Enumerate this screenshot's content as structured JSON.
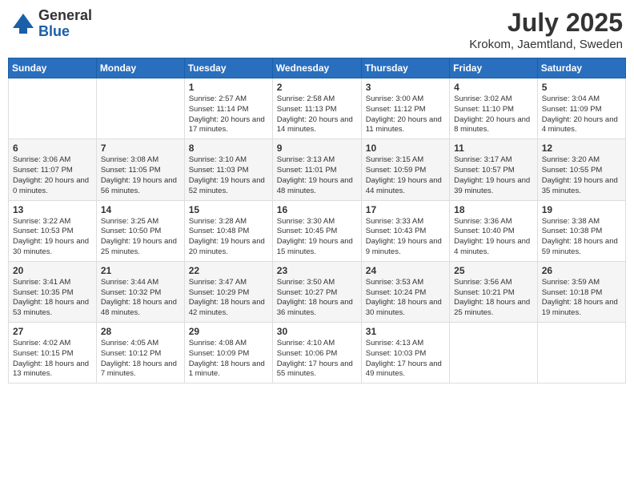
{
  "header": {
    "logo_general": "General",
    "logo_blue": "Blue",
    "month_year": "July 2025",
    "location": "Krokom, Jaemtland, Sweden"
  },
  "weekdays": [
    "Sunday",
    "Monday",
    "Tuesday",
    "Wednesday",
    "Thursday",
    "Friday",
    "Saturday"
  ],
  "weeks": [
    [
      {
        "day": "",
        "content": ""
      },
      {
        "day": "",
        "content": ""
      },
      {
        "day": "1",
        "content": "Sunrise: 2:57 AM\nSunset: 11:14 PM\nDaylight: 20 hours\nand 17 minutes."
      },
      {
        "day": "2",
        "content": "Sunrise: 2:58 AM\nSunset: 11:13 PM\nDaylight: 20 hours\nand 14 minutes."
      },
      {
        "day": "3",
        "content": "Sunrise: 3:00 AM\nSunset: 11:12 PM\nDaylight: 20 hours\nand 11 minutes."
      },
      {
        "day": "4",
        "content": "Sunrise: 3:02 AM\nSunset: 11:10 PM\nDaylight: 20 hours\nand 8 minutes."
      },
      {
        "day": "5",
        "content": "Sunrise: 3:04 AM\nSunset: 11:09 PM\nDaylight: 20 hours\nand 4 minutes."
      }
    ],
    [
      {
        "day": "6",
        "content": "Sunrise: 3:06 AM\nSunset: 11:07 PM\nDaylight: 20 hours\nand 0 minutes."
      },
      {
        "day": "7",
        "content": "Sunrise: 3:08 AM\nSunset: 11:05 PM\nDaylight: 19 hours\nand 56 minutes."
      },
      {
        "day": "8",
        "content": "Sunrise: 3:10 AM\nSunset: 11:03 PM\nDaylight: 19 hours\nand 52 minutes."
      },
      {
        "day": "9",
        "content": "Sunrise: 3:13 AM\nSunset: 11:01 PM\nDaylight: 19 hours\nand 48 minutes."
      },
      {
        "day": "10",
        "content": "Sunrise: 3:15 AM\nSunset: 10:59 PM\nDaylight: 19 hours\nand 44 minutes."
      },
      {
        "day": "11",
        "content": "Sunrise: 3:17 AM\nSunset: 10:57 PM\nDaylight: 19 hours\nand 39 minutes."
      },
      {
        "day": "12",
        "content": "Sunrise: 3:20 AM\nSunset: 10:55 PM\nDaylight: 19 hours\nand 35 minutes."
      }
    ],
    [
      {
        "day": "13",
        "content": "Sunrise: 3:22 AM\nSunset: 10:53 PM\nDaylight: 19 hours\nand 30 minutes."
      },
      {
        "day": "14",
        "content": "Sunrise: 3:25 AM\nSunset: 10:50 PM\nDaylight: 19 hours\nand 25 minutes."
      },
      {
        "day": "15",
        "content": "Sunrise: 3:28 AM\nSunset: 10:48 PM\nDaylight: 19 hours\nand 20 minutes."
      },
      {
        "day": "16",
        "content": "Sunrise: 3:30 AM\nSunset: 10:45 PM\nDaylight: 19 hours\nand 15 minutes."
      },
      {
        "day": "17",
        "content": "Sunrise: 3:33 AM\nSunset: 10:43 PM\nDaylight: 19 hours\nand 9 minutes."
      },
      {
        "day": "18",
        "content": "Sunrise: 3:36 AM\nSunset: 10:40 PM\nDaylight: 19 hours\nand 4 minutes."
      },
      {
        "day": "19",
        "content": "Sunrise: 3:38 AM\nSunset: 10:38 PM\nDaylight: 18 hours\nand 59 minutes."
      }
    ],
    [
      {
        "day": "20",
        "content": "Sunrise: 3:41 AM\nSunset: 10:35 PM\nDaylight: 18 hours\nand 53 minutes."
      },
      {
        "day": "21",
        "content": "Sunrise: 3:44 AM\nSunset: 10:32 PM\nDaylight: 18 hours\nand 48 minutes."
      },
      {
        "day": "22",
        "content": "Sunrise: 3:47 AM\nSunset: 10:29 PM\nDaylight: 18 hours\nand 42 minutes."
      },
      {
        "day": "23",
        "content": "Sunrise: 3:50 AM\nSunset: 10:27 PM\nDaylight: 18 hours\nand 36 minutes."
      },
      {
        "day": "24",
        "content": "Sunrise: 3:53 AM\nSunset: 10:24 PM\nDaylight: 18 hours\nand 30 minutes."
      },
      {
        "day": "25",
        "content": "Sunrise: 3:56 AM\nSunset: 10:21 PM\nDaylight: 18 hours\nand 25 minutes."
      },
      {
        "day": "26",
        "content": "Sunrise: 3:59 AM\nSunset: 10:18 PM\nDaylight: 18 hours\nand 19 minutes."
      }
    ],
    [
      {
        "day": "27",
        "content": "Sunrise: 4:02 AM\nSunset: 10:15 PM\nDaylight: 18 hours\nand 13 minutes."
      },
      {
        "day": "28",
        "content": "Sunrise: 4:05 AM\nSunset: 10:12 PM\nDaylight: 18 hours\nand 7 minutes."
      },
      {
        "day": "29",
        "content": "Sunrise: 4:08 AM\nSunset: 10:09 PM\nDaylight: 18 hours\nand 1 minute."
      },
      {
        "day": "30",
        "content": "Sunrise: 4:10 AM\nSunset: 10:06 PM\nDaylight: 17 hours\nand 55 minutes."
      },
      {
        "day": "31",
        "content": "Sunrise: 4:13 AM\nSunset: 10:03 PM\nDaylight: 17 hours\nand 49 minutes."
      },
      {
        "day": "",
        "content": ""
      },
      {
        "day": "",
        "content": ""
      }
    ]
  ]
}
